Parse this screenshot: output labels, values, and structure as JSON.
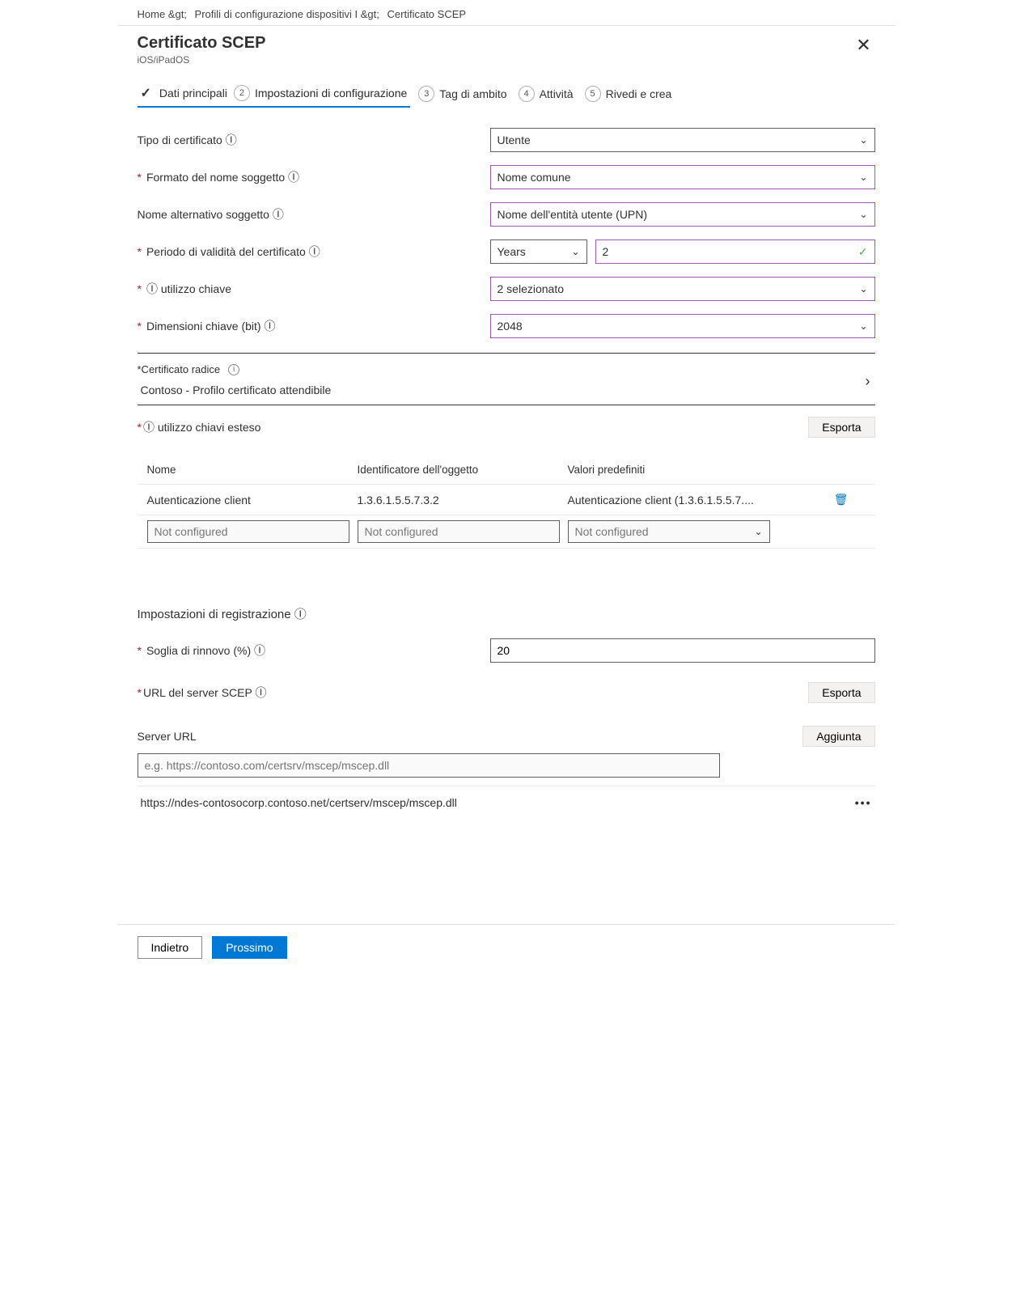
{
  "breadcrumb": {
    "p0": "Home &gt;",
    "p1": "Profili di configurazione dispositivi I &gt;",
    "p2": "Certificato SCEP"
  },
  "header": {
    "title": "Certificato SCEP",
    "subtitle": "iOS/iPadOS"
  },
  "wizard": {
    "s1": "Dati principali",
    "s2": "Impostazioni di configurazione",
    "s3": "Tag di ambito",
    "s4": "Attività",
    "s5": "Rivedi e crea",
    "n2": "2",
    "n3": "3",
    "n4": "4",
    "n5": "5"
  },
  "form": {
    "cert_type_label": "Tipo di certificato Ⓘ",
    "cert_type_value": "Utente",
    "subject_format_label": "Formato del nome soggetto Ⓘ",
    "subject_format_value": "Nome comune",
    "san_label": "Nome alternativo soggetto Ⓘ",
    "san_value": "Nome dell'entità utente (UPN)",
    "validity_label": "Periodo di validità del certificato Ⓘ",
    "validity_unit": "Years",
    "validity_value": "2",
    "key_usage_label": "Ⓘ utilizzo chiave",
    "key_usage_value": "2 selezionato",
    "key_size_label": "Dimensioni chiave (bit) Ⓘ",
    "key_size_value": "2048"
  },
  "rootcert": {
    "label": "*Certificato radice",
    "value": "Contoso - Profilo certificato attendibile"
  },
  "eku": {
    "label": "Ⓘ utilizzo chiavi esteso",
    "export": "Esporta",
    "th1": "Nome",
    "th2": "Identificatore dell'oggetto",
    "th3": "Valori predefiniti",
    "r1c1": "Autenticazione client",
    "r1c2": "1.3.6.1.5.5.7.3.2",
    "r1c3": "Autenticazione client (1.3.6.1.5.5.7....",
    "ph": "Not configured"
  },
  "enroll": {
    "heading": "Impostazioni di registrazione Ⓘ",
    "renewal_label": "Soglia di rinnovo (%) Ⓘ",
    "renewal_value": "20",
    "urls_label": "URL del server SCEP Ⓘ",
    "export": "Esporta",
    "server_url_head": "Server URL",
    "add": "Aggiunta",
    "placeholder": "e.g. https://contoso.com/certsrv/mscep/mscep.dll",
    "url1": "https://ndes-contosocorp.contoso.net/certserv/mscep/mscep.dll"
  },
  "footer": {
    "back": "Indietro",
    "next": "Prossimo"
  }
}
